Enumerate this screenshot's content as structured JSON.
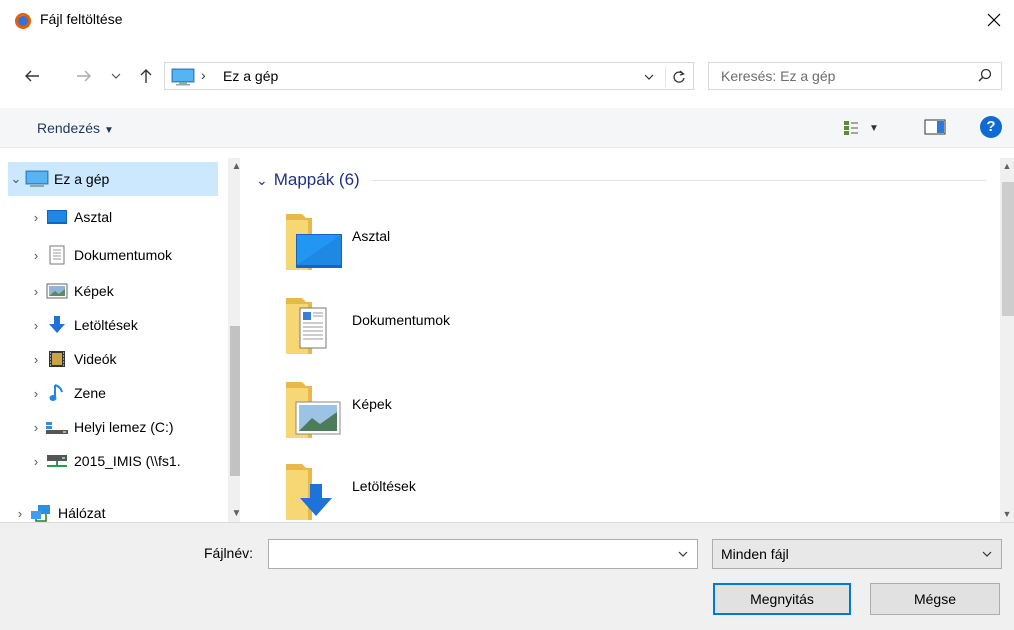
{
  "window": {
    "title": "Fájl feltöltése",
    "app_icon": "firefox-icon",
    "close_icon": "close-icon"
  },
  "nav": {
    "back_icon": "arrow-left-icon",
    "forward_icon": "arrow-right-icon",
    "recent_icon": "chevron-down-icon",
    "up_icon": "arrow-up-icon",
    "address": {
      "location_icon": "this-pc-icon",
      "separator": "›",
      "path": "Ez a gép"
    },
    "search_placeholder": "Keresés: Ez a gép"
  },
  "toolbar": {
    "organize_label": "Rendezés",
    "view_icon": "view-options-icon",
    "preview_icon": "preview-pane-icon",
    "help_label": "?"
  },
  "sidebar": {
    "items": [
      {
        "label": "Ez a gép",
        "icon": "this-pc-icon",
        "selected": true,
        "expanded": true
      },
      {
        "label": "Asztal",
        "icon": "desktop-icon"
      },
      {
        "label": "Dokumentumok",
        "icon": "documents-icon"
      },
      {
        "label": "Képek",
        "icon": "pictures-icon"
      },
      {
        "label": "Letöltések",
        "icon": "downloads-icon"
      },
      {
        "label": "Videók",
        "icon": "videos-icon"
      },
      {
        "label": "Zene",
        "icon": "music-icon"
      },
      {
        "label": "Helyi lemez (C:)",
        "icon": "local-disk-icon"
      },
      {
        "label": "2015_IMIS (\\\\fs1.",
        "icon": "network-drive-icon"
      },
      {
        "label": "Hálózat",
        "icon": "network-icon"
      }
    ]
  },
  "main": {
    "group_title": "Mappák (6)",
    "folders": [
      {
        "label": "Asztal",
        "icon": "desktop-folder-icon"
      },
      {
        "label": "Dokumentumok",
        "icon": "documents-folder-icon"
      },
      {
        "label": "Képek",
        "icon": "pictures-folder-icon"
      },
      {
        "label": "Letöltések",
        "icon": "downloads-folder-icon"
      }
    ]
  },
  "footer": {
    "filename_label": "Fájlnév:",
    "filename_value": "",
    "filter_value": "Minden fájl",
    "open_label": "Megnyitás",
    "cancel_label": "Mégse"
  },
  "colors": {
    "accent": "#0078d7",
    "selection": "#cce8ff",
    "group_header": "#1e3287",
    "folder": "#f7d774"
  }
}
